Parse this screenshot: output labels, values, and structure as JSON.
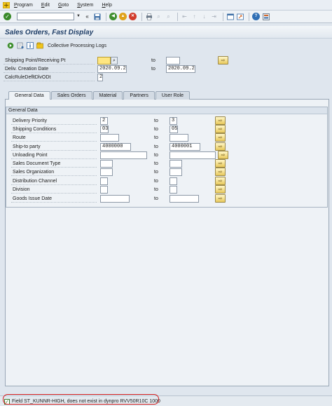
{
  "menu": [
    "Program",
    "Edit",
    "Goto",
    "System",
    "Help"
  ],
  "toolbar": {
    "command_field": "",
    "icons": [
      "enter-icon",
      "save-icon",
      "back-icon",
      "exit-icon",
      "cancel-icon",
      "print-icon",
      "find-icon",
      "find-next-icon",
      "first-page-icon",
      "previous-page-icon",
      "next-page-icon",
      "last-page-icon",
      "create-session-icon",
      "shortcut-icon",
      "help-icon",
      "customize-layout-icon"
    ]
  },
  "title": "Sales Orders, Fast Display",
  "app_toolbar": {
    "collective_label": "Collective Processing Logs"
  },
  "header_fields": {
    "shipping_point": {
      "label": "Shipping Point/Receiving Pt",
      "from": "",
      "to": ""
    },
    "delivery_creation_date": {
      "label": "Deliv. Creation Date",
      "from": "2020.09.23",
      "to": "2020.09.23"
    },
    "calc_rule": {
      "label": "CalcRuleDefltDlvODt",
      "value": "2"
    },
    "to_label": "to"
  },
  "tabs": [
    "General Data",
    "Sales Orders",
    "Material",
    "Partners",
    "User Role"
  ],
  "group_title": "General Data",
  "general_rows": [
    {
      "label": "Delivery Priority",
      "from": "2",
      "to": "3"
    },
    {
      "label": "Shipping Conditions",
      "from": "03",
      "to": "05"
    },
    {
      "label": "Route",
      "from": "",
      "to": ""
    },
    {
      "label": "Ship-to party",
      "from": "4000000",
      "to": "4000001"
    },
    {
      "label": "Unloading Point",
      "from": "",
      "to": ""
    },
    {
      "label": "Sales Document Type",
      "from": "",
      "to": ""
    },
    {
      "label": "Sales Organization",
      "from": "",
      "to": ""
    },
    {
      "label": "Distribution Channel",
      "from": "",
      "to": ""
    },
    {
      "label": "Division",
      "from": "",
      "to": ""
    },
    {
      "label": "Goods Issue Date",
      "from": "",
      "to": ""
    }
  ],
  "status": {
    "message": "Field ST_KUNNR-HIGH, does not exist in dynpro RVV50R10C 1000"
  },
  "colors": {
    "annotation": "#d21e1e",
    "required_field": "#ffe680",
    "title": "#1e3d66"
  }
}
